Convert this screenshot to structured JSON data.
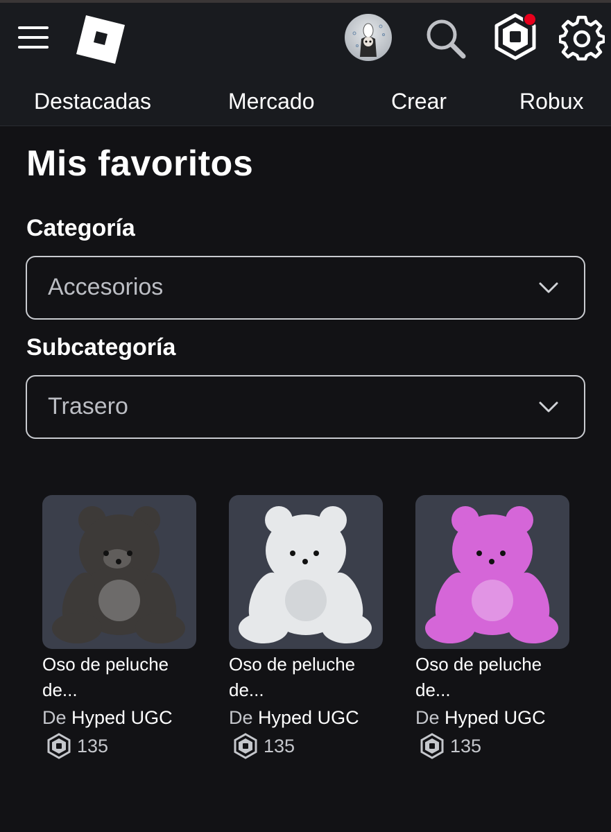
{
  "header": {
    "nav": [
      "Destacadas",
      "Mercado",
      "Crear",
      "Robux"
    ],
    "icons": [
      "menu-icon",
      "roblox-logo",
      "avatar",
      "search-icon",
      "robux-icon",
      "gear-icon"
    ],
    "notification": true
  },
  "page": {
    "title": "Mis favoritos"
  },
  "filters": {
    "category_label": "Categoría",
    "category_value": "Accesorios",
    "subcategory_label": "Subcategoría",
    "subcategory_value": "Trasero"
  },
  "items": [
    {
      "name": "Oso de peluche de...",
      "by": "De",
      "creator": "Hyped UGC",
      "price": "135",
      "color": "#3d3a38"
    },
    {
      "name": "Oso de peluche de...",
      "by": "De",
      "creator": "Hyped UGC",
      "price": "135",
      "color": "#e6e8ea"
    },
    {
      "name": "Oso de peluche de...",
      "by": "De",
      "creator": "Hyped UGC",
      "price": "135",
      "color": "#d566d8"
    }
  ],
  "colors": {
    "background": "#121215",
    "header": "#191b1f",
    "thumb_bg": "#3b3f4b",
    "notification": "#e8001c"
  }
}
